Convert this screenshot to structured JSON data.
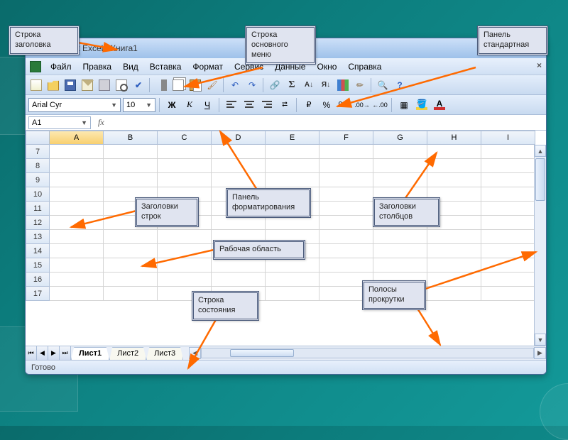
{
  "window": {
    "title": "Microsoft Excel - Книга1"
  },
  "menu": {
    "items": [
      "Файл",
      "Правка",
      "Вид",
      "Вставка",
      "Формат",
      "Сервис",
      "Данные",
      "Окно",
      "Справка"
    ]
  },
  "format": {
    "font": "Arial Cyr",
    "size": "10",
    "bold": "Ж",
    "italic": "К",
    "underline": "Ч"
  },
  "namebox": "A1",
  "fx_label": "fx",
  "columns": [
    "A",
    "B",
    "C",
    "D",
    "E",
    "F",
    "G",
    "H",
    "I"
  ],
  "rows": [
    "7",
    "8",
    "9",
    "10",
    "11",
    "12",
    "13",
    "14",
    "15",
    "16",
    "17"
  ],
  "tabs": {
    "nav": [
      "⏮",
      "◀",
      "▶",
      "⏭"
    ],
    "sheets": [
      "Лист1",
      "Лист2",
      "Лист3"
    ]
  },
  "status": "Готово",
  "callouts": {
    "titlebar": "Строка заголовка",
    "menubar": "Строка основного меню",
    "standard_toolbar": "Панель стандартная",
    "rowheaders": "Заголовки строк",
    "format_panel": "Панель форматирования",
    "colheaders": "Заголовки столбцов",
    "workarea": "Рабочая область",
    "statusbar": "Строка состояния",
    "scrollbars": "Полосы прокрутки"
  }
}
